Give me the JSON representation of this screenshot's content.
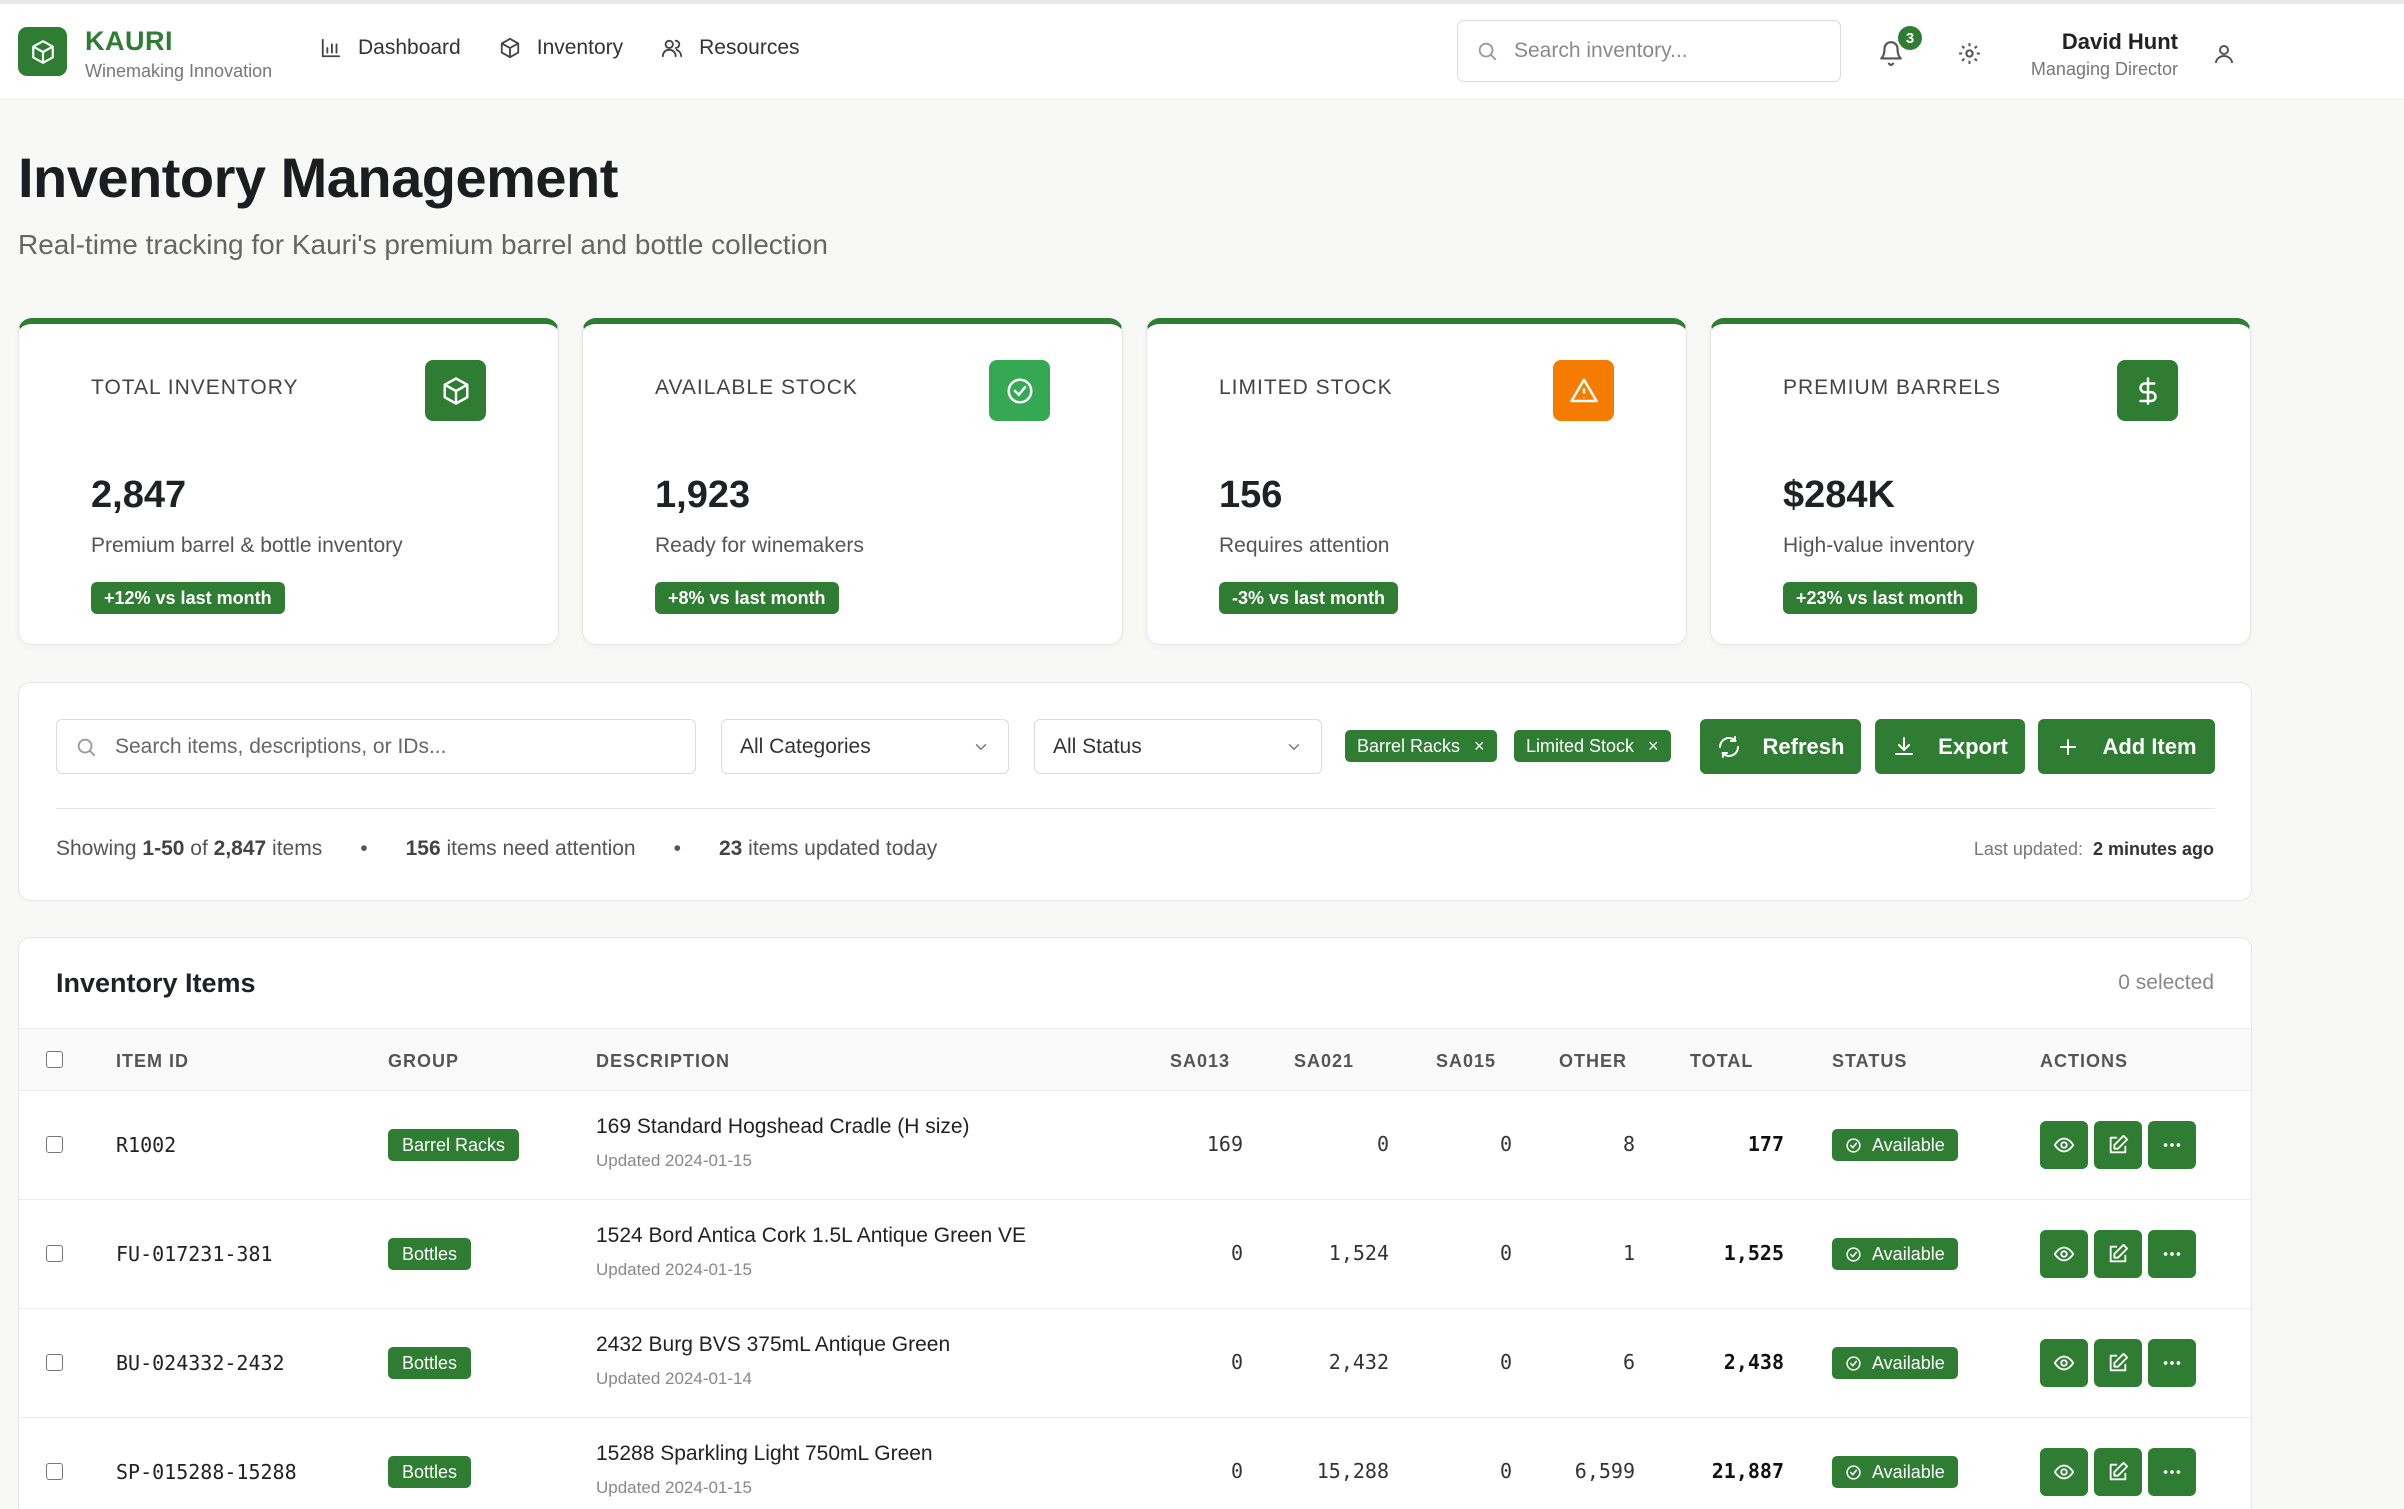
{
  "header": {
    "brand_name": "KAURI",
    "brand_tagline": "Winemaking Innovation",
    "nav": [
      {
        "label": "Dashboard",
        "icon": "bar-chart-icon"
      },
      {
        "label": "Inventory",
        "icon": "box-icon"
      },
      {
        "label": "Resources",
        "icon": "users-icon"
      }
    ],
    "search_placeholder": "Search inventory...",
    "notification_count": "3",
    "user_name": "David Hunt",
    "user_role": "Managing Director"
  },
  "page": {
    "title": "Inventory Management",
    "subtitle": "Real-time tracking for Kauri's premium barrel and bottle collection"
  },
  "stats": [
    {
      "label": "TOTAL INVENTORY",
      "value": "2,847",
      "desc": "Premium barrel & bottle inventory",
      "badge": "+12% vs last month",
      "icon": "box-icon",
      "icon_color": "#2e7d32"
    },
    {
      "label": "AVAILABLE STOCK",
      "value": "1,923",
      "desc": "Ready for winemakers",
      "badge": "+8% vs last month",
      "icon": "check-circle-icon",
      "icon_color": "#34a853"
    },
    {
      "label": "LIMITED STOCK",
      "value": "156",
      "desc": "Requires attention",
      "badge": "-3% vs last month",
      "icon": "warning-icon",
      "icon_color": "#f57c00"
    },
    {
      "label": "PREMIUM BARRELS",
      "value": "$284K",
      "desc": "High-value inventory",
      "badge": "+23% vs last month",
      "icon": "dollar-icon",
      "icon_color": "#2e7d32"
    }
  ],
  "filters": {
    "search_placeholder": "Search items, descriptions, or IDs...",
    "category": "All Categories",
    "status": "All Status",
    "chips": [
      "Barrel Racks",
      "Limited Stock"
    ],
    "buttons": {
      "refresh": "Refresh",
      "export": "Export",
      "add": "Add Item"
    },
    "summary": {
      "showing_prefix": "Showing",
      "range": "1-50",
      "of": "of",
      "total": "2,847",
      "items": "items",
      "attention_count": "156",
      "attention_text": "items need attention",
      "updated_count": "23",
      "updated_text": "items updated today"
    },
    "last_updated_label": "Last updated:",
    "last_updated_value": "2 minutes ago"
  },
  "table": {
    "title": "Inventory Items",
    "selected": "0 selected",
    "columns": [
      "ITEM ID",
      "GROUP",
      "DESCRIPTION",
      "SA013",
      "SA021",
      "SA015",
      "OTHER",
      "TOTAL",
      "STATUS",
      "ACTIONS"
    ],
    "rows": [
      {
        "id": "R1002",
        "group": "Barrel Racks",
        "desc": "169 Standard Hogshead Cradle (H size)",
        "updated": "Updated 2024-01-15",
        "sa013": "169",
        "sa021": "0",
        "sa015": "0",
        "other": "8",
        "total": "177",
        "status": "Available"
      },
      {
        "id": "FU-017231-381",
        "group": "Bottles",
        "desc": "1524 Bord Antica Cork 1.5L Antique Green VE",
        "updated": "Updated 2024-01-15",
        "sa013": "0",
        "sa021": "1,524",
        "sa015": "0",
        "other": "1",
        "total": "1,525",
        "status": "Available"
      },
      {
        "id": "BU-024332-2432",
        "group": "Bottles",
        "desc": "2432 Burg BVS 375mL Antique Green",
        "updated": "Updated 2024-01-14",
        "sa013": "0",
        "sa021": "2,432",
        "sa015": "0",
        "other": "6",
        "total": "2,438",
        "status": "Available"
      },
      {
        "id": "SP-015288-15288",
        "group": "Bottles",
        "desc": "15288 Sparkling Light 750mL Green",
        "updated": "Updated 2024-01-15",
        "sa013": "0",
        "sa021": "15,288",
        "sa015": "0",
        "other": "6,599",
        "total": "21,887",
        "status": "Available"
      }
    ]
  }
}
